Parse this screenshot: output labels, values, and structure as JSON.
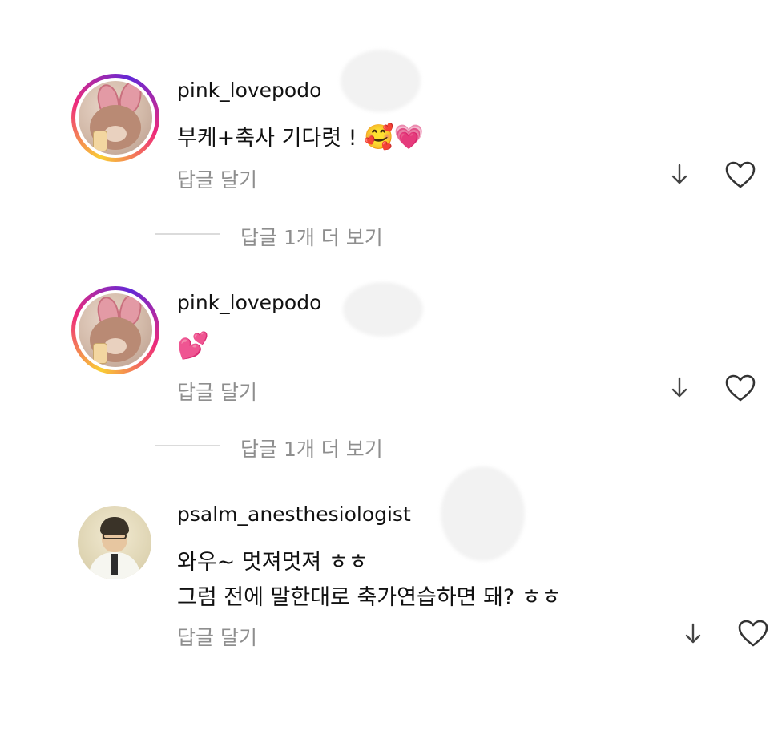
{
  "comments": [
    {
      "username": "pink_lovepodo",
      "text": "부케+축사 기다렷 !",
      "emoji": "🥰💗",
      "reply_label": "답글 달기",
      "more_replies": "답글 1개 더 보기",
      "icons": [
        "translate-down-icon",
        "heart-icon"
      ]
    },
    {
      "username": "pink_lovepodo",
      "text": "",
      "emoji": "💕",
      "reply_label": "답글 달기",
      "more_replies": "답글 1개 더 보기",
      "icons": [
        "translate-down-icon",
        "heart-icon"
      ]
    },
    {
      "username": "psalm_anesthesiologist",
      "line1": "와우~ 멋져멋져 ㅎㅎ",
      "line2": "그럼 전에 말한대로 축가연습하면 돼? ㅎㅎ",
      "reply_label": "답글 달기",
      "icons": [
        "translate-down-icon",
        "heart-icon"
      ]
    }
  ],
  "colors": {
    "text": "#111111",
    "meta": "#8e8e8e",
    "ring_start": "#f9ce34",
    "ring_mid": "#ee2a7b"
  }
}
